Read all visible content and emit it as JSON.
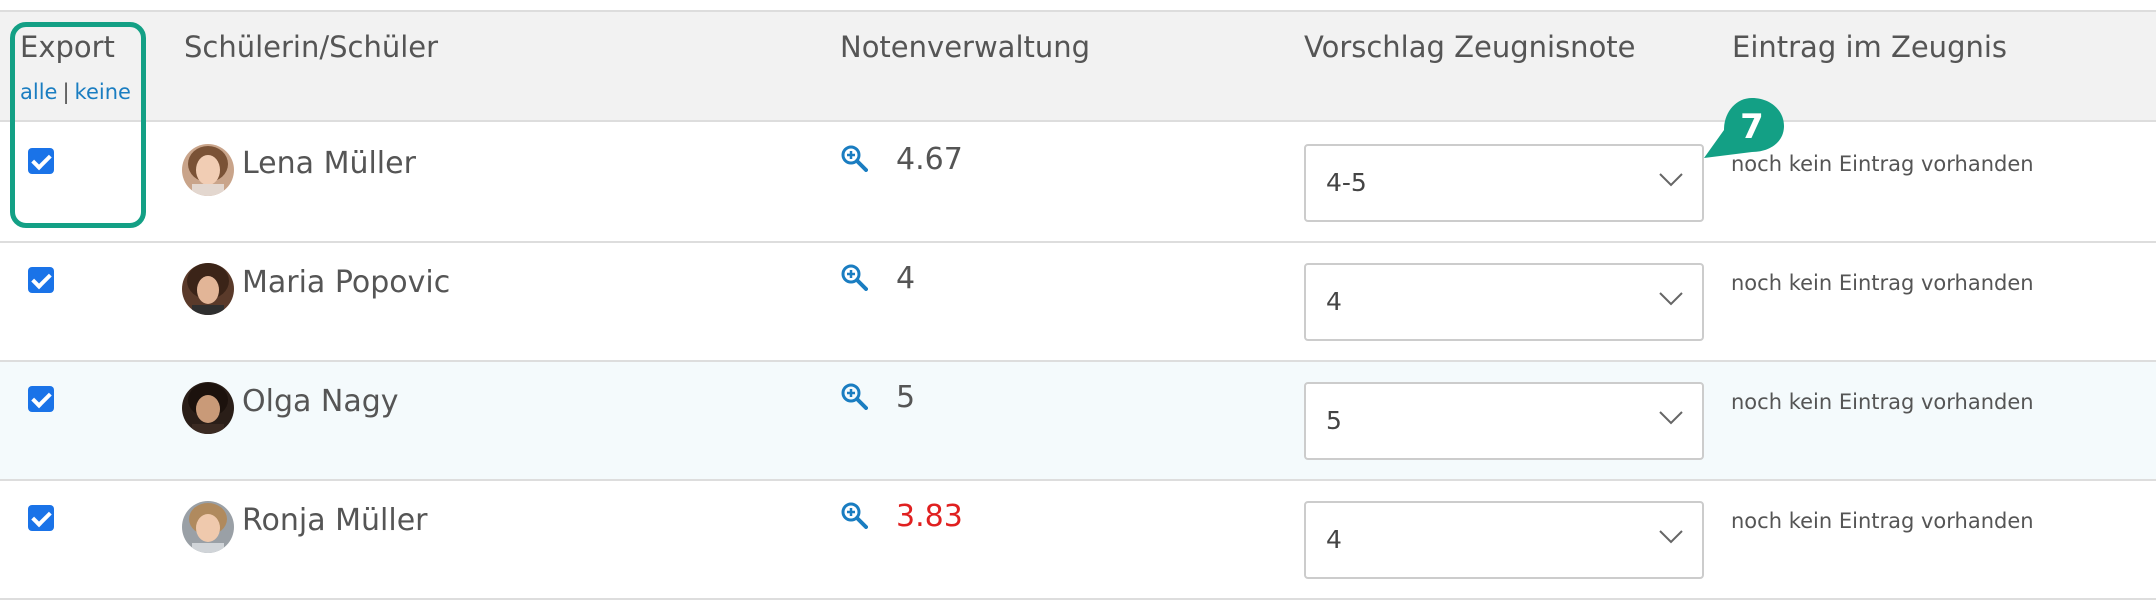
{
  "header": {
    "export": "Export",
    "select_all": "alle",
    "separator": "|",
    "select_none": "keine",
    "student": "Schülerin/Schüler",
    "grades": "Notenverwaltung",
    "suggestion": "Vorschlag Zeugnisnote",
    "report_entry": "Eintrag im Zeugnis"
  },
  "rows": [
    {
      "name": "Lena Müller",
      "grade": "4.67",
      "suggestion": "4-5",
      "entry": "noch kein Eintrag vorhanden",
      "checked": true
    },
    {
      "name": "Maria Popovic",
      "grade": "4",
      "suggestion": "4",
      "entry": "noch kein Eintrag vorhanden",
      "checked": true
    },
    {
      "name": "Olga Nagy",
      "grade": "5",
      "suggestion": "5",
      "entry": "noch kein Eintrag vorhanden",
      "checked": true
    },
    {
      "name": "Ronja Müller",
      "grade": "3.83",
      "suggestion": "4",
      "entry": "noch kein Eintrag vorhanden",
      "checked": true
    }
  ],
  "marker": {
    "label": "7"
  },
  "colors": {
    "accent": "#1a7dc1",
    "highlight": "#13a085",
    "warning": "#e02020"
  },
  "icons": [
    "zoom-in-icon",
    "chevron-down-icon",
    "checkbox-checked-icon"
  ]
}
